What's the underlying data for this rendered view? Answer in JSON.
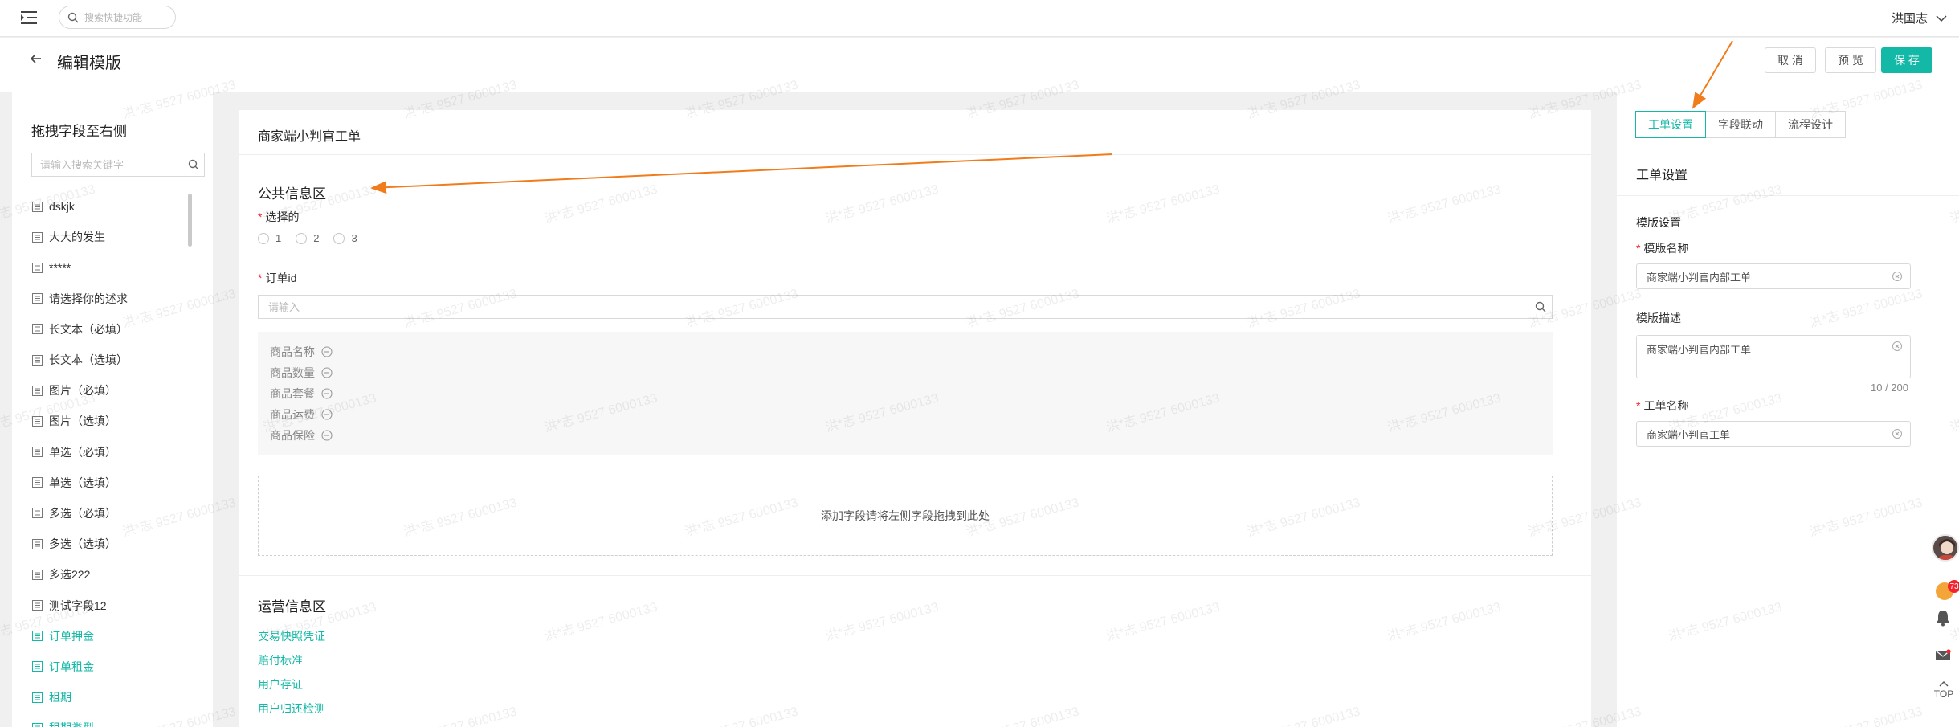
{
  "header": {
    "search_placeholder": "搜索快捷功能",
    "user_name": "洪国志"
  },
  "title_bar": {
    "title": "编辑模版",
    "cancel_label": "取 消",
    "preview_label": "预 览",
    "save_label": "保 存"
  },
  "left_panel": {
    "title": "拖拽字段至右侧",
    "search_placeholder": "请输入搜索关键字",
    "fields": [
      {
        "label": "dskjk",
        "teal": false
      },
      {
        "label": "大大的发生",
        "teal": false
      },
      {
        "label": "*****",
        "teal": false
      },
      {
        "label": "请选择你的述求",
        "teal": false
      },
      {
        "label": "长文本（必填）",
        "teal": false
      },
      {
        "label": "长文本（选填）",
        "teal": false
      },
      {
        "label": "图片（必填）",
        "teal": false
      },
      {
        "label": "图片（选填）",
        "teal": false
      },
      {
        "label": "单选（必填）",
        "teal": false
      },
      {
        "label": "单选（选填）",
        "teal": false
      },
      {
        "label": "多选（必填）",
        "teal": false
      },
      {
        "label": "多选（选填）",
        "teal": false
      },
      {
        "label": "多选222",
        "teal": false
      },
      {
        "label": "测试字段12",
        "teal": false
      },
      {
        "label": "订单押金",
        "teal": true
      },
      {
        "label": "订单租金",
        "teal": true
      },
      {
        "label": "租期",
        "teal": true
      },
      {
        "label": "租期类型",
        "teal": true
      }
    ]
  },
  "form": {
    "title": "商家端小判官工单",
    "public_section": {
      "title": "公共信息区",
      "radio_field": {
        "label": "选择的",
        "options": [
          "1",
          "2",
          "3"
        ]
      },
      "order_field": {
        "label": "订单id",
        "placeholder": "请输入"
      },
      "product_items": [
        "商品名称",
        "商品数量",
        "商品套餐",
        "商品运费",
        "商品保险"
      ],
      "dropzone_text": "添加字段请将左侧字段拖拽到此处"
    },
    "ops_section": {
      "title": "运营信息区",
      "links": [
        "交易快照凭证",
        "赔付标准",
        "用户存证",
        "用户归还检测"
      ]
    }
  },
  "right_panel": {
    "tabs": [
      {
        "label": "工单设置",
        "active": true
      },
      {
        "label": "字段联动",
        "active": false
      },
      {
        "label": "流程设计",
        "active": false
      }
    ],
    "section_title": "工单设置",
    "subsection_title": "模版设置",
    "template_name": {
      "label": "模版名称",
      "value": "商家端小判官内部工单"
    },
    "template_desc": {
      "label": "模版描述",
      "value": "商家端小判官内部工单",
      "count": "10 / 200"
    },
    "ticket_name": {
      "label": "工单名称",
      "value": "商家端小判官工单"
    }
  },
  "float_bar": {
    "badge_count": "73",
    "top_label": "TOP"
  },
  "watermark": {
    "text": "洪*志 9527 6000133"
  },
  "colors": {
    "accent": "#13b8a6",
    "required": "#f5222d",
    "annotation_arrow": "#f07c1b"
  }
}
